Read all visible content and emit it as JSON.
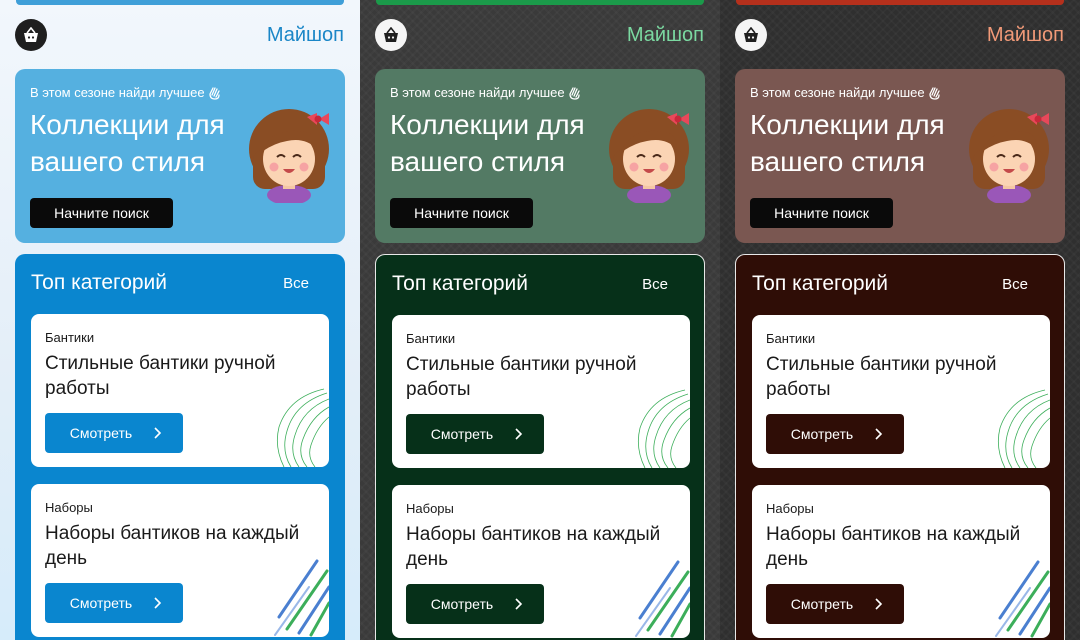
{
  "screens": [
    {
      "theme": "light",
      "brand": "Майшоп",
      "hero": {
        "subtitle": "В этом сезоне найди лучшее",
        "title": "Коллекции для вашего стиля",
        "button": "Начните поиск"
      },
      "categories": {
        "title": "Топ категорий",
        "all_link": "Все",
        "cards": [
          {
            "category": "Бантики",
            "title": "Стильные бантики ручной работы",
            "button": "Смотреть"
          },
          {
            "category": "Наборы",
            "title": "Наборы бантиков на каждый день",
            "button": "Смотреть"
          }
        ]
      },
      "accent": "#0a86cf"
    },
    {
      "theme": "green",
      "brand": "Майшоп",
      "hero": {
        "subtitle": "В этом сезоне найди лучшее",
        "title": "Коллекции для вашего стиля",
        "button": "Начните поиск"
      },
      "categories": {
        "title": "Топ категорий",
        "all_link": "Все",
        "cards": [
          {
            "category": "Бантики",
            "title": "Стильные бантики ручной работы",
            "button": "Смотреть"
          },
          {
            "category": "Наборы",
            "title": "Наборы бантиков на каждый день",
            "button": "Смотреть"
          }
        ]
      },
      "accent": "#063019"
    },
    {
      "theme": "red",
      "brand": "Майшоп",
      "hero": {
        "subtitle": "В этом сезоне найди лучшее",
        "title": "Коллекции для вашего стиля",
        "button": "Начните поиск"
      },
      "categories": {
        "title": "Топ категорий",
        "all_link": "Все",
        "cards": [
          {
            "category": "Бантики",
            "title": "Стильные бантики ручной работы",
            "button": "Смотреть"
          },
          {
            "category": "Наборы",
            "title": "Наборы бантиков на каждый день",
            "button": "Смотреть"
          }
        ]
      },
      "accent": "#2f0d06"
    }
  ],
  "icons": [
    "shopping-basket-icon",
    "waving-hand-icon",
    "girl-illustration",
    "chevron-right-icon",
    "leaf-line-decor",
    "diagonal-stripes-decor"
  ]
}
